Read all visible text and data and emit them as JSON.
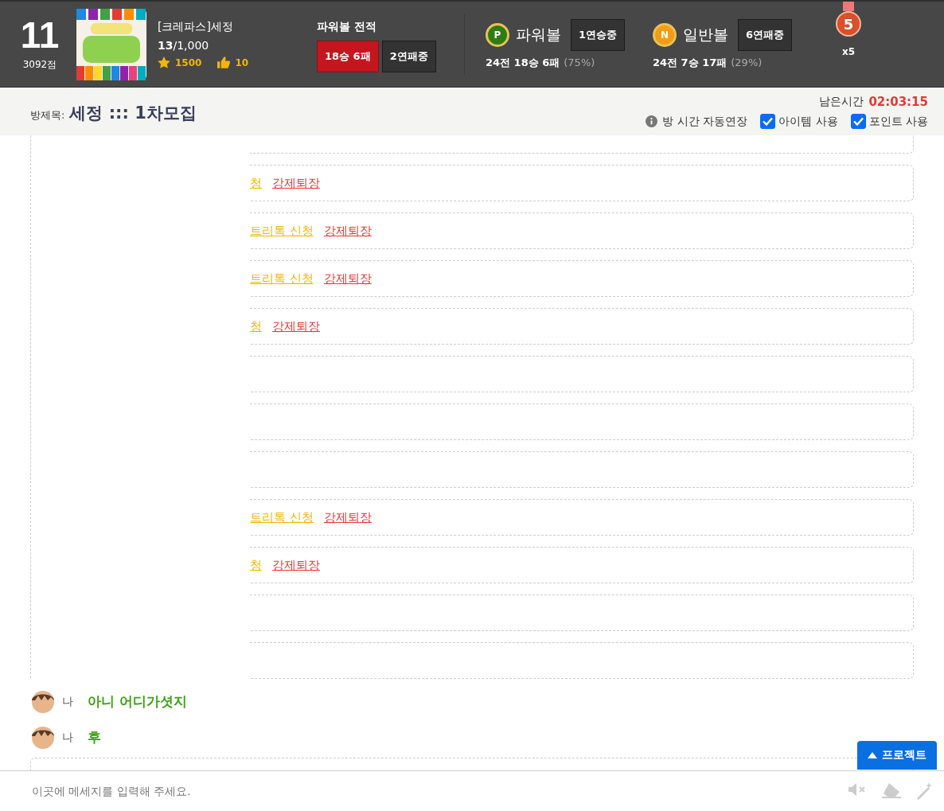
{
  "profile": {
    "level": "11",
    "points": "3092점",
    "name": "[크레파스]세정",
    "count_bold": "13",
    "count_rest": "/1,000",
    "stars": "1500",
    "likes": "10"
  },
  "record": {
    "title": "파워볼 전적",
    "result": "18승 6패",
    "streak": "2연패중"
  },
  "balls": [
    {
      "badge": "P",
      "color": "#2e7d12",
      "name": "파워볼",
      "streak": "1연승중",
      "summary": "24전 18승 6패",
      "percent": "(75%)"
    },
    {
      "badge": "N",
      "color": "#f39c12",
      "name": "일반볼",
      "streak": "6연패중",
      "summary": "24전 7승 17패",
      "percent": "(29%)"
    }
  ],
  "medal": {
    "number": "5",
    "count": "x5"
  },
  "room": {
    "label": "방제목:",
    "title": "세정 ::: 1차모집",
    "time_label": "남은시간",
    "time": "02:03:15",
    "auto_extend": "방 시간 자동연장",
    "options": [
      {
        "label": "아이템 사용",
        "checked": true
      },
      {
        "label": "포인트 사용",
        "checked": true
      }
    ]
  },
  "rows": [
    {
      "request": "청",
      "kick": "강제퇴장"
    },
    {
      "request": "트리톡 신청",
      "kick": "강제퇴장"
    },
    {
      "request": "트리톡 신청",
      "kick": "강제퇴장"
    },
    {
      "request": "청",
      "kick": "강제퇴장"
    },
    {},
    {},
    {},
    {
      "request": "트리톡 신청",
      "kick": "강제퇴장"
    },
    {
      "request": "청",
      "kick": "강제퇴장"
    },
    {},
    {}
  ],
  "chat": [
    {
      "user": "나",
      "message": "아니 어디가셧지"
    },
    {
      "user": "나",
      "message": "후"
    }
  ],
  "project_button": "프로젝트",
  "input": {
    "placeholder": "이곳에 메세지를 입력해 주세요."
  }
}
